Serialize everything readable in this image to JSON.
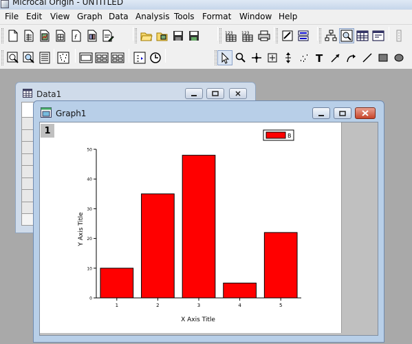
{
  "app": {
    "title": "Microcal Origin - UNTITLED"
  },
  "menu": [
    "File",
    "Edit",
    "View",
    "Graph",
    "Data",
    "Analysis",
    "Tools",
    "Format",
    "Window",
    "Help"
  ],
  "toolbar1": {
    "group1": [
      "new-project-icon",
      "new-worksheet-icon",
      "new-graph-icon",
      "new-matrix-icon",
      "new-function-icon",
      "new-layout-icon",
      "new-notes-icon"
    ],
    "group2": [
      "open-icon",
      "open-template-icon",
      "save-project-icon",
      "save-template-icon"
    ],
    "group3": [
      "import-ascii-icon",
      "print-icon"
    ],
    "group4": [
      "results-log-icon",
      "layer-icon"
    ],
    "group5": [
      "project-explorer-icon",
      "zoom-mode-icon",
      "worksheet-tool-icon",
      "script-window-icon"
    ],
    "group6": [
      "code-builder-icon"
    ]
  },
  "toolbar2": {
    "group1": [
      "rescale-icon",
      "zoom-in-icon",
      "zoom-out-icon"
    ],
    "group2": [
      "data-display-icon"
    ],
    "group3": [
      "layout-1-icon",
      "layout-2-icon",
      "layout-3-icon"
    ],
    "group4": [
      "data-reader-icon",
      "clock-icon"
    ],
    "tools": [
      "pointer-icon",
      "magnifier-icon",
      "screen-reader-icon",
      "data-reader-tool-icon",
      "data-selector-icon",
      "draw-data-icon",
      "text-tool-icon",
      "arrow-tool-icon",
      "curved-arrow-icon",
      "line-tool-icon",
      "rectangle-tool-icon",
      "oval-tool-icon"
    ]
  },
  "data_window": {
    "title": "Data1"
  },
  "graph_window": {
    "title": "Graph1",
    "layer_label": "1"
  },
  "colors": {
    "bar": "#ff0000",
    "close_button": "#c7442a"
  },
  "chart_data": {
    "type": "bar",
    "categories": [
      "1",
      "2",
      "3",
      "4",
      "5"
    ],
    "series": [
      {
        "name": "B",
        "values": [
          10,
          35,
          48,
          5,
          22
        ],
        "color": "#ff0000"
      }
    ],
    "xlabel": "X Axis Title",
    "ylabel": "Y Axis Title",
    "ylim": [
      0,
      50
    ],
    "yticks": [
      "0",
      "10",
      "20",
      "30",
      "40",
      "50"
    ],
    "grid": false,
    "legend": "top-right"
  }
}
